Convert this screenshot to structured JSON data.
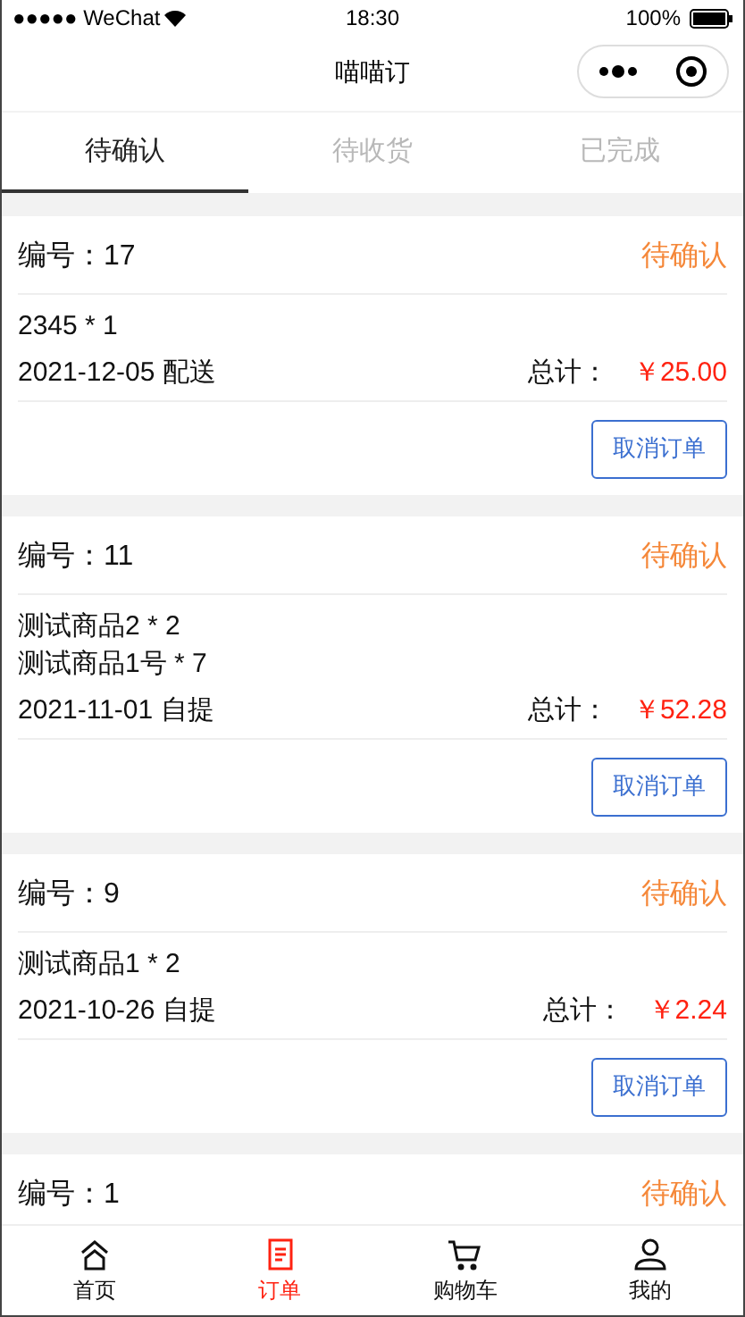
{
  "status_bar": {
    "carrier": "●●●●● WeChat",
    "time": "18:30",
    "battery": "100%"
  },
  "nav": {
    "title": "喵喵订"
  },
  "tabs": [
    {
      "label": "待确认",
      "selected": true
    },
    {
      "label": "待收货",
      "selected": false
    },
    {
      "label": "已完成",
      "selected": false
    }
  ],
  "orders": [
    {
      "number": "编号：17",
      "status": "待确认",
      "items": [
        "2345 * 1"
      ],
      "date": "2021-12-05 配送",
      "total_label": "总计：",
      "total": "￥25.00",
      "action": "取消订单"
    },
    {
      "number": "编号：11",
      "status": "待确认",
      "items": [
        "测试商品2 * 2",
        "测试商品1号 * 7"
      ],
      "date": "2021-11-01 自提",
      "total_label": "总计：",
      "total": "￥52.28",
      "action": "取消订单"
    },
    {
      "number": "编号：9",
      "status": "待确认",
      "items": [
        "测试商品1 * 2"
      ],
      "date": "2021-10-26 自提",
      "total_label": "总计：",
      "total": "￥2.24",
      "action": "取消订单"
    },
    {
      "number": "编号：1",
      "status": "待确认"
    }
  ],
  "tab_bar": [
    {
      "kind": "home",
      "label": "首页",
      "selected": false
    },
    {
      "kind": "orders",
      "label": "订单",
      "selected": true
    },
    {
      "kind": "cart",
      "label": "购物车",
      "selected": false
    },
    {
      "kind": "profile",
      "label": "我的",
      "selected": false
    }
  ]
}
